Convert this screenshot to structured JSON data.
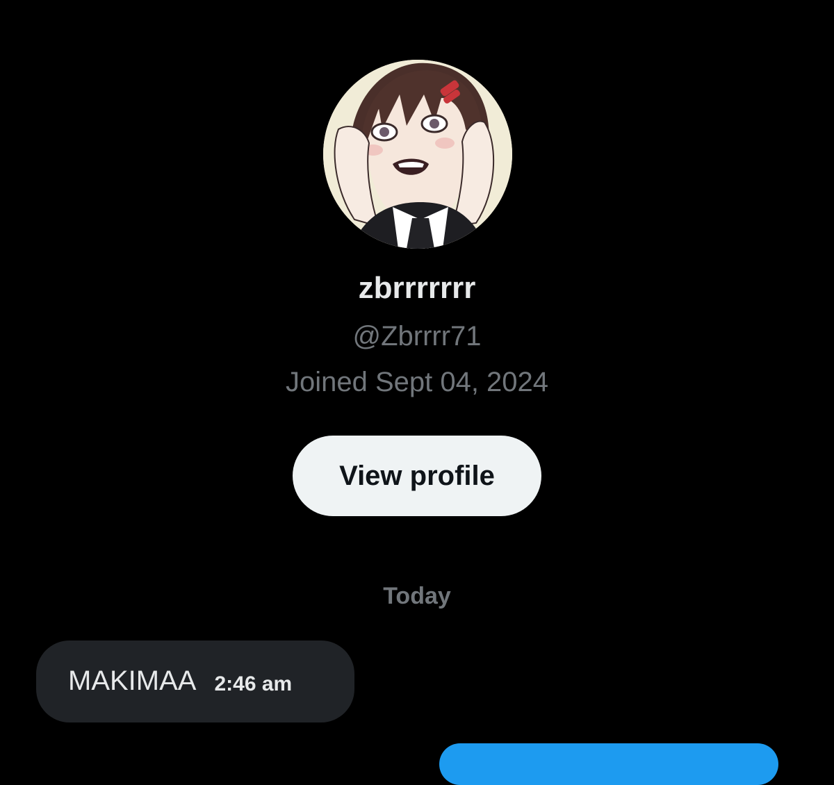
{
  "profile": {
    "display_name": "zbrrrrrrr",
    "handle": "@Zbrrrr71",
    "joined": "Joined Sept 04, 2024",
    "avatar_icon": "anime-character-avatar"
  },
  "actions": {
    "view_profile_label": "View profile"
  },
  "conversation": {
    "date_divider": "Today",
    "messages": [
      {
        "direction": "received",
        "text": "MAKIMAA",
        "time": "2:46 am"
      }
    ]
  },
  "colors": {
    "background": "#000000",
    "primary_text": "#e7e9ea",
    "secondary_text": "#71767b",
    "button_bg": "#eff3f4",
    "received_bubble": "#202327",
    "sent_bubble": "#1d9bf0"
  }
}
